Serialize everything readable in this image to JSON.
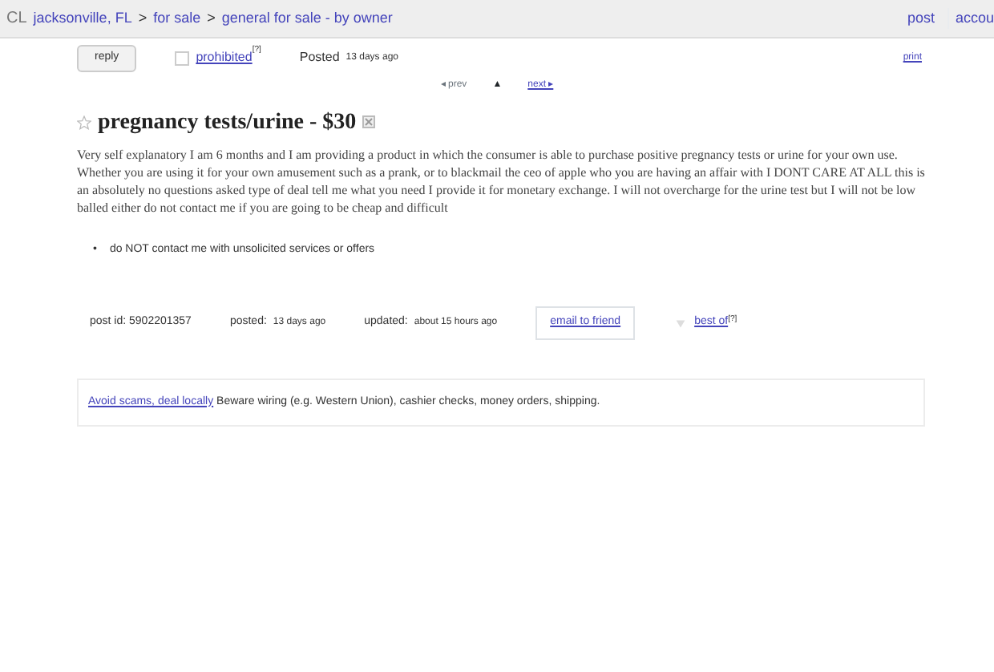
{
  "header": {
    "logo": "CL",
    "breadcrumbs": [
      {
        "label": "jacksonville, FL"
      },
      {
        "label": "for sale"
      },
      {
        "label": "general for sale - by owner"
      }
    ],
    "separator": ">",
    "links": [
      "post",
      "accou"
    ]
  },
  "actions": {
    "reply": "reply",
    "prohibited": {
      "label": "prohibited",
      "note": "[?]",
      "checked": false
    },
    "posted_label": "Posted",
    "posted_time": "13 days ago",
    "print": "print"
  },
  "pager": {
    "prev": "◂ prev",
    "up": "▲",
    "next": "next ▸"
  },
  "posting": {
    "favorited": false,
    "title": "pregnancy tests/urine - $30",
    "body": "Very self explanatory I am 6 months and I am providing a product in which the consumer is able to purchase positive pregnancy tests or urine for your own use. Whether you are using it for your own amusement such as a prank, or to blackmail the ceo of apple who you are having an affair with I DONT CARE AT ALL this is an absolutely no questions asked type of deal tell me what you need I provide it for monetary exchange. I will not overcharge for the urine test but I will not be low balled either do not contact me if you are going to be cheap and difficult",
    "notices": [
      {
        "bullet": "•",
        "text": "do NOT contact me with unsolicited services or offers"
      }
    ]
  },
  "postinfo": {
    "post_id": "post id: 5902201357",
    "posted_label": "posted:",
    "posted_time": "13 days ago",
    "updated_label": "updated:",
    "updated_time": "about 15 hours ago",
    "email": "email to friend",
    "best_of": {
      "label": "best of",
      "note": "[?]",
      "checked": false
    }
  },
  "scam_notice": {
    "link": "Avoid scams, deal locally",
    "text": "Beware wiring (e.g. Western Union), cashier checks, money orders, shipping."
  }
}
